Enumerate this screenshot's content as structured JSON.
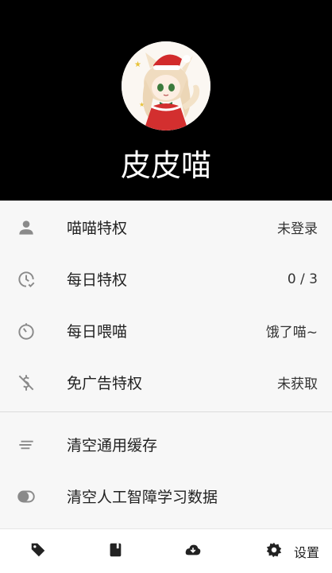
{
  "profile": {
    "username": "皮皮喵",
    "avatar_icon": "anime-cat-girl-avatar"
  },
  "menu": [
    {
      "label": "喵喵特权",
      "value": "未登录",
      "icon": "person-icon"
    },
    {
      "label": "每日特权",
      "value": "0 / 3",
      "icon": "clock-check-icon"
    },
    {
      "label": "每日喂喵",
      "value": "饿了喵~",
      "icon": "timer-icon"
    },
    {
      "label": "免广告特权",
      "value": "未获取",
      "icon": "money-off-icon"
    }
  ],
  "actions": [
    {
      "label": "清空通用缓存",
      "icon": "clear-lines-icon"
    },
    {
      "label": "清空人工智障学习数据",
      "icon": "toggle-icon"
    }
  ],
  "tabbar": {
    "tabs": [
      {
        "icon": "tag-icon"
      },
      {
        "icon": "book-icon"
      },
      {
        "icon": "cloud-download-icon"
      },
      {
        "icon": "gear-icon",
        "label": "设置",
        "active": true
      }
    ]
  },
  "colors": {
    "header_bg": "#000000",
    "body_bg": "#f7f7f7",
    "icon_gray": "#8a8a8a",
    "text_dark": "#222222"
  }
}
